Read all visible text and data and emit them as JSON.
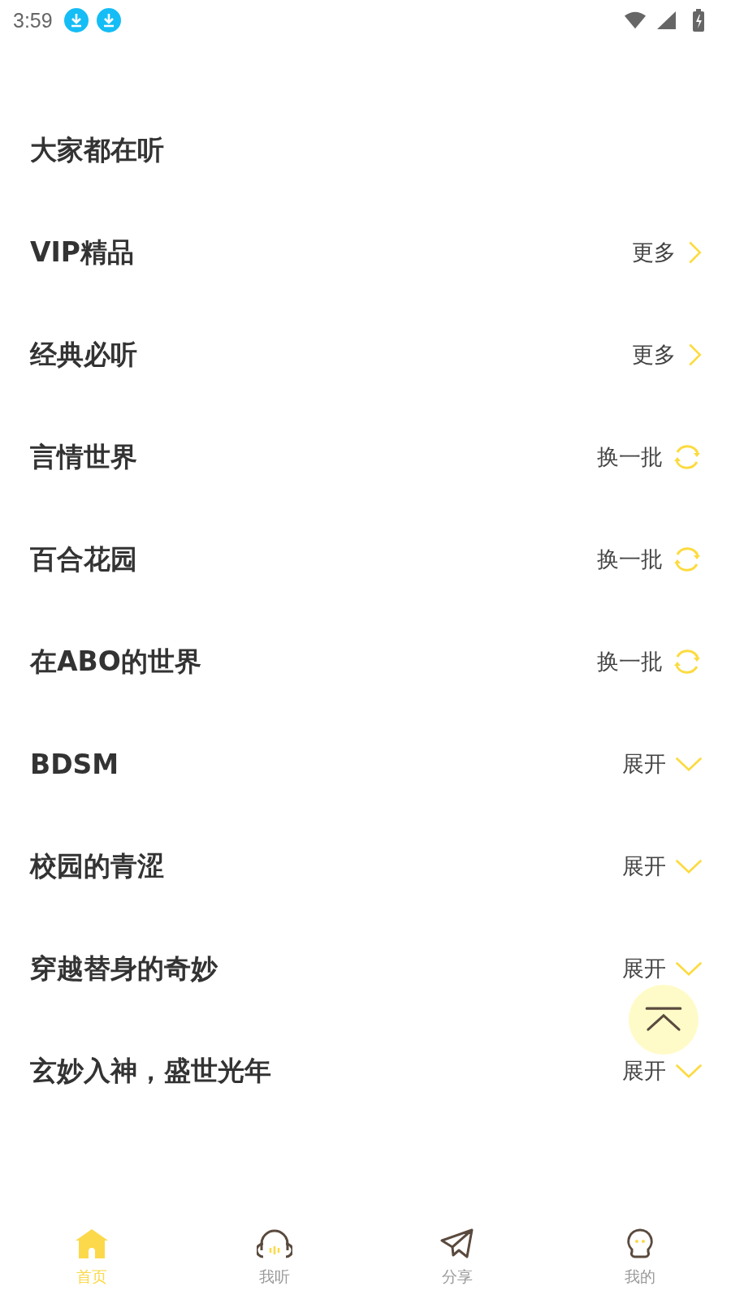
{
  "status_bar": {
    "time": "3:59"
  },
  "sections": [
    {
      "title": "大家都在听",
      "kind": "none"
    },
    {
      "title": "VIP精品",
      "kind": "more",
      "action": "更多"
    },
    {
      "title": "经典必听",
      "kind": "more",
      "action": "更多"
    },
    {
      "title": "言情世界",
      "kind": "refresh",
      "action": "换一批"
    },
    {
      "title": "百合花园",
      "kind": "refresh",
      "action": "换一批"
    },
    {
      "title": "在ABO的世界",
      "kind": "refresh",
      "action": "换一批"
    },
    {
      "title": "BDSM",
      "kind": "expand",
      "action": "展开"
    },
    {
      "title": "校园的青涩",
      "kind": "expand",
      "action": "展开"
    },
    {
      "title": "穿越替身的奇妙",
      "kind": "expand",
      "action": "展开"
    },
    {
      "title": "玄妙入神，盛世光年",
      "kind": "expand",
      "action": "展开"
    }
  ],
  "nav": [
    {
      "label": "首页",
      "kind": "home",
      "selected": true
    },
    {
      "label": "我听",
      "kind": "listen",
      "selected": false
    },
    {
      "label": "分享",
      "kind": "share",
      "selected": false
    },
    {
      "label": "我的",
      "kind": "me",
      "selected": false
    }
  ]
}
